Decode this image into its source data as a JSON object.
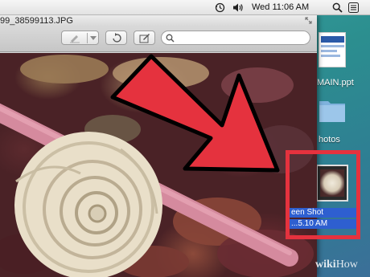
{
  "menubar": {
    "clock": "Wed 11:06 AM",
    "icons": [
      "time-machine-icon",
      "volume-icon",
      "spotlight-search-icon",
      "notification-list-icon"
    ]
  },
  "window": {
    "title": "99_38599113.JPG",
    "toolbar": {
      "buttons": [
        "markup-icon",
        "dropdown-icon",
        "rotate-icon",
        "edit-icon"
      ],
      "search": {
        "value": "",
        "placeholder": ""
      }
    }
  },
  "desktop": {
    "items": [
      {
        "label": "MAIN.ppt",
        "icon": "powerpoint-thumbnail"
      },
      {
        "label": "hotos",
        "icon": "folder-icon"
      },
      {
        "label_lines": [
          "een Shot",
          "...5.10 AM"
        ],
        "icon": "screenshot-thumbnail"
      }
    ]
  },
  "annotation": {
    "arrow_color": "#e5323e",
    "highlight_color": "#e5323e"
  },
  "watermark": {
    "wiki": "wiki",
    "how": "How"
  }
}
